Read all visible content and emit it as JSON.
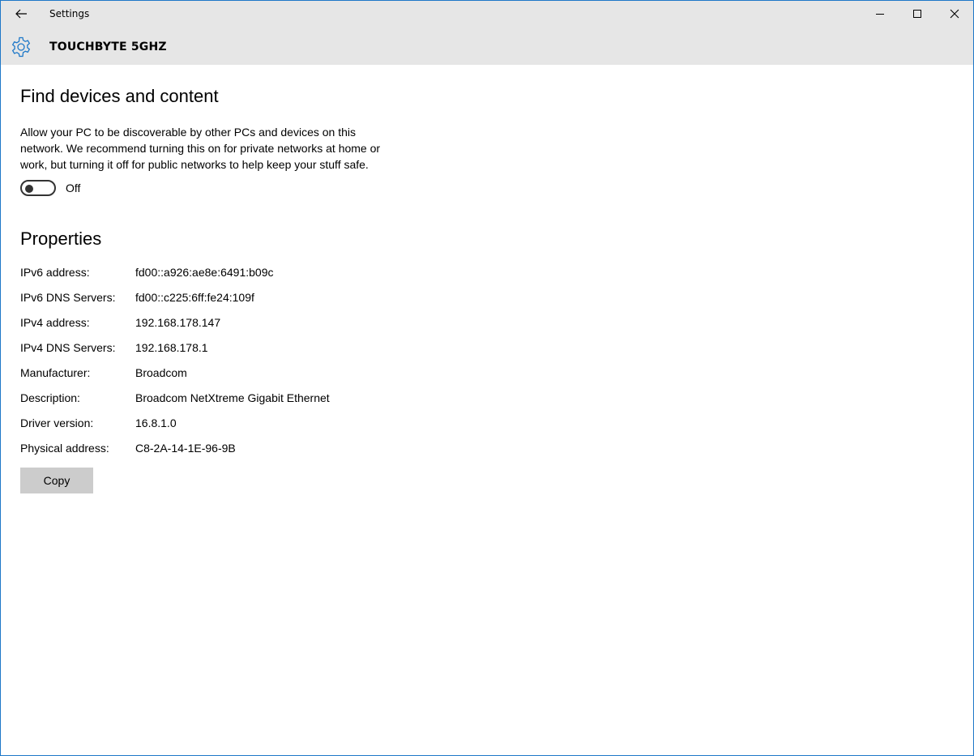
{
  "window": {
    "title": "Settings",
    "header_network": "TOUCHBYTE 5GHZ",
    "accent_color": "#1e78c8"
  },
  "icons": {
    "back": "back-arrow-icon",
    "gear": "gear-icon",
    "minimize": "minimize-icon",
    "maximize": "maximize-icon",
    "close": "close-icon"
  },
  "discovery": {
    "title": "Find devices and content",
    "description": "Allow your PC to be discoverable by other PCs and devices on this network. We recommend turning this on for private networks at home or work, but turning it off for public networks to help keep your stuff safe.",
    "toggle_state": "Off"
  },
  "properties": {
    "title": "Properties",
    "rows": [
      {
        "label": "IPv6 address:",
        "value": "fd00::a926:ae8e:6491:b09c"
      },
      {
        "label": "IPv6 DNS Servers:",
        "value": "fd00::c225:6ff:fe24:109f"
      },
      {
        "label": "IPv4 address:",
        "value": "192.168.178.147"
      },
      {
        "label": "IPv4 DNS Servers:",
        "value": "192.168.178.1"
      },
      {
        "label": "Manufacturer:",
        "value": "Broadcom"
      },
      {
        "label": "Description:",
        "value": "Broadcom NetXtreme Gigabit Ethernet"
      },
      {
        "label": "Driver version:",
        "value": "16.8.1.0"
      },
      {
        "label": "Physical address:",
        "value": "C8-2A-14-1E-96-9B"
      }
    ],
    "copy_label": "Copy"
  }
}
